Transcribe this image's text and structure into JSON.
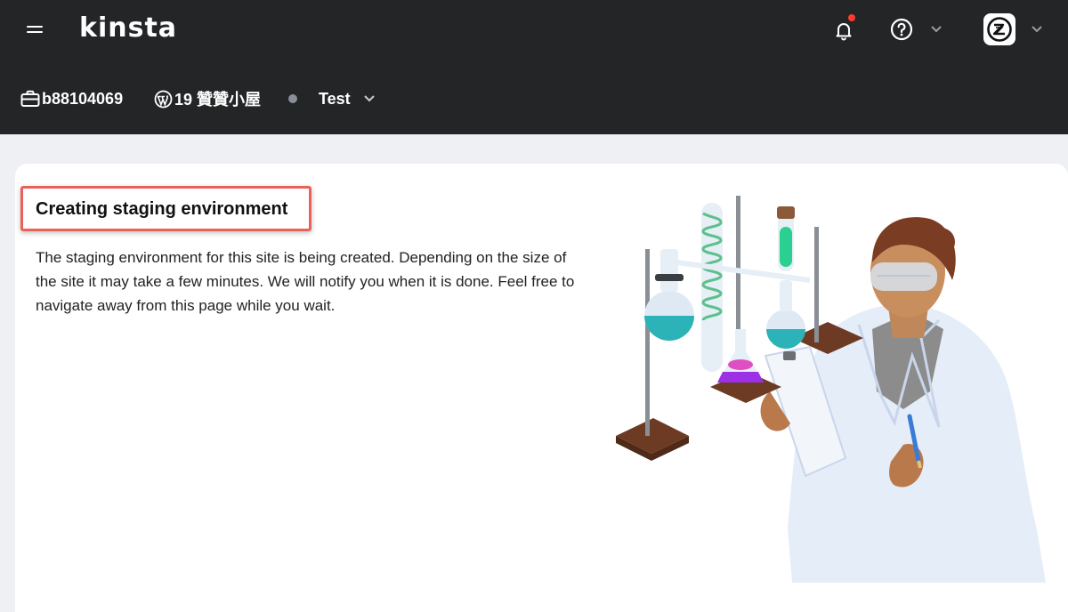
{
  "header": {
    "logo": "kinsta",
    "icons": {
      "menu": "hamburger-icon",
      "notifications": "bell-icon",
      "help": "help-icon"
    },
    "notification_dot_color": "#ff3b30"
  },
  "subbar": {
    "company": "b88104069",
    "site": "19 贊贊小屋",
    "environment": "Test",
    "environment_dot_color": "#8a8f99"
  },
  "content": {
    "title": "Creating staging environment",
    "description": "The staging environment for this site is being created. Depending on the size of the site it may take a few minutes. We will notify you when it is done. Feel free to navigate away from this page while you wait.",
    "highlight_color": "#e8625a"
  },
  "colors": {
    "topbar": "#232526",
    "page_bg": "#eef0f4",
    "card_bg": "#ffffff"
  }
}
